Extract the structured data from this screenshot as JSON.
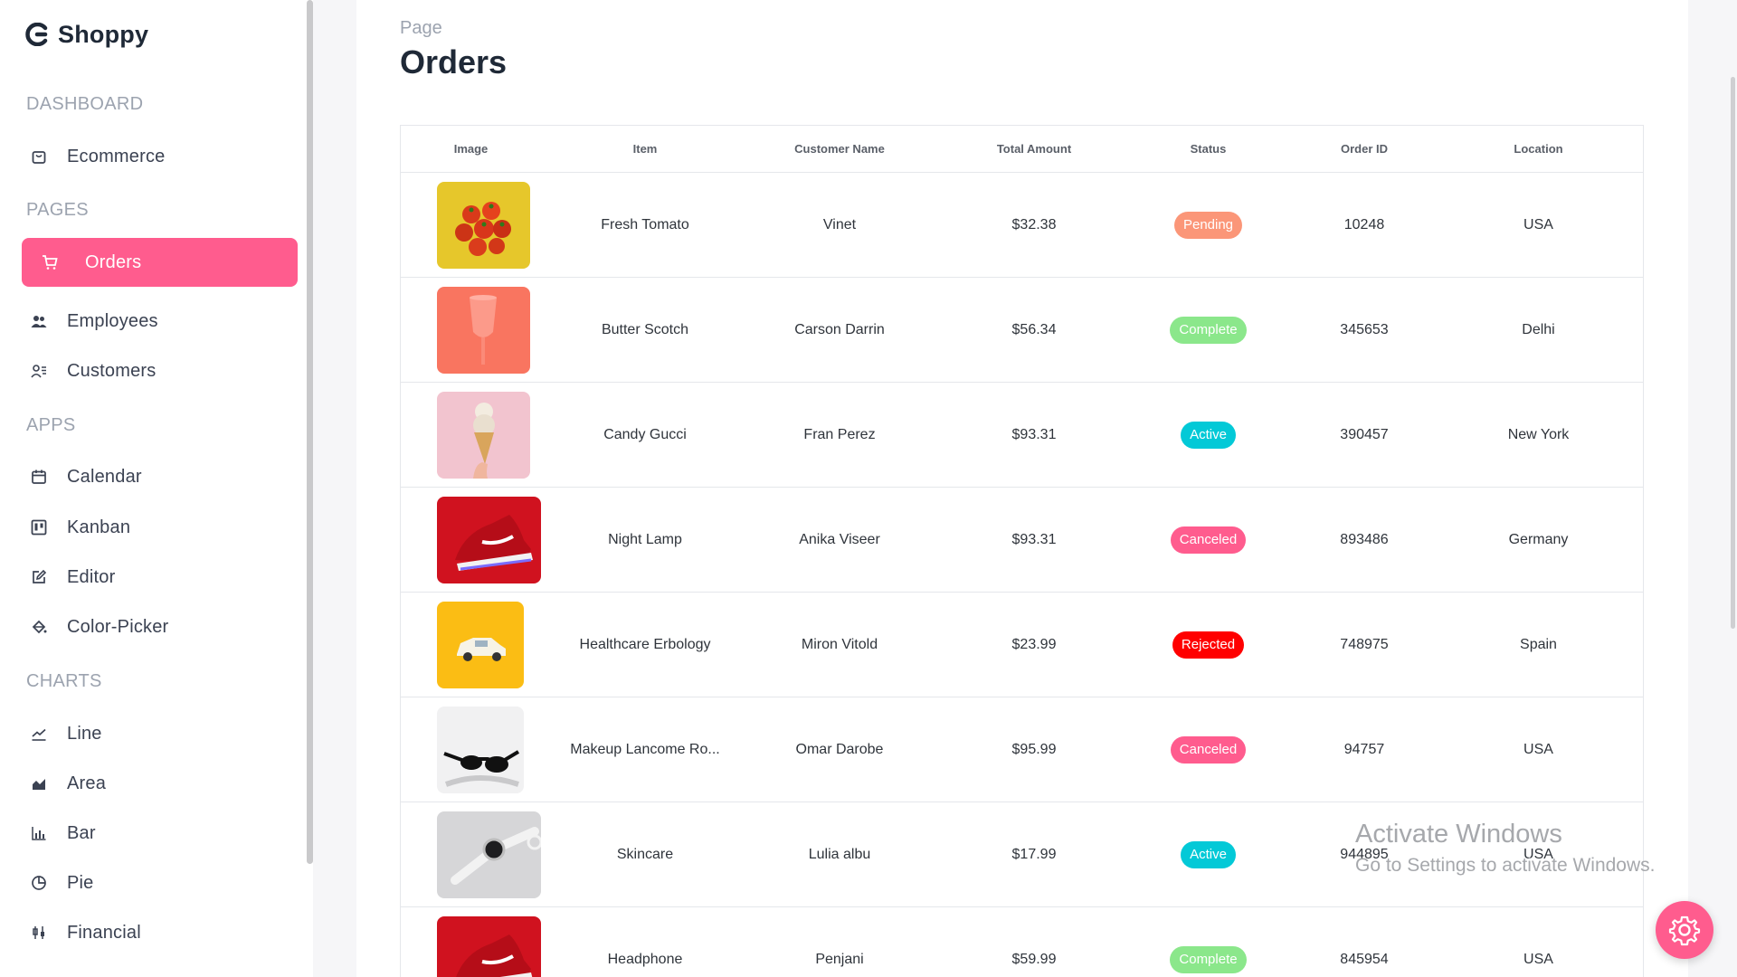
{
  "brand": {
    "name": "Shoppy"
  },
  "sidebar": {
    "sections": {
      "dashboard": "DASHBOARD",
      "pages": "PAGES",
      "apps": "APPS",
      "charts": "CHARTS"
    },
    "items": {
      "ecommerce": "Ecommerce",
      "orders": "Orders",
      "employees": "Employees",
      "customers": "Customers",
      "calendar": "Calendar",
      "kanban": "Kanban",
      "editor": "Editor",
      "color_picker": "Color-Picker",
      "line": "Line",
      "area": "Area",
      "bar": "Bar",
      "pie": "Pie",
      "financial": "Financial"
    },
    "active_item": "Orders"
  },
  "header": {
    "label": "Page",
    "title": "Orders"
  },
  "table": {
    "columns": [
      "Image",
      "Item",
      "Customer Name",
      "Total Amount",
      "Status",
      "Order ID",
      "Location"
    ],
    "rows": [
      {
        "item": "Fresh Tomato",
        "customer": "Vinet",
        "amount": "$32.38",
        "status": "Pending",
        "order_id": "10248",
        "location": "USA",
        "image": "tomato-image"
      },
      {
        "item": "Butter Scotch",
        "customer": "Carson Darrin",
        "amount": "$56.34",
        "status": "Complete",
        "order_id": "345653",
        "location": "Delhi",
        "image": "glass-image"
      },
      {
        "item": "Candy Gucci",
        "customer": "Fran Perez",
        "amount": "$93.31",
        "status": "Active",
        "order_id": "390457",
        "location": "New York",
        "image": "icecream-image"
      },
      {
        "item": "Night Lamp",
        "customer": "Anika Viseer",
        "amount": "$93.31",
        "status": "Canceled",
        "order_id": "893486",
        "location": "Germany",
        "image": "shoe-image"
      },
      {
        "item": "Healthcare Erbology",
        "customer": "Miron Vitold",
        "amount": "$23.99",
        "status": "Rejected",
        "order_id": "748975",
        "location": "Spain",
        "image": "toy-car-image"
      },
      {
        "item": "Makeup Lancome Ro...",
        "customer": "Omar Darobe",
        "amount": "$95.99",
        "status": "Canceled",
        "order_id": "94757",
        "location": "USA",
        "image": "sunglasses-image"
      },
      {
        "item": "Skincare",
        "customer": "Lulia albu",
        "amount": "$17.99",
        "status": "Active",
        "order_id": "944895",
        "location": "USA",
        "image": "watch-image"
      },
      {
        "item": "Headphone",
        "customer": "Penjani",
        "amount": "$59.99",
        "status": "Complete",
        "order_id": "845954",
        "location": "USA",
        "image": "shoe-image"
      }
    ]
  },
  "status_colors": {
    "Pending": "#fb9678",
    "Complete": "#8be78b",
    "Active": "#03c9d7",
    "Canceled": "#ff5c8e",
    "Rejected": "#ff0000"
  },
  "accent_color": "#ff5c8e",
  "watermark": {
    "line1": "Activate Windows",
    "line2": "Go to Settings to activate Windows."
  },
  "settings_button": {
    "icon": "gear-icon"
  }
}
